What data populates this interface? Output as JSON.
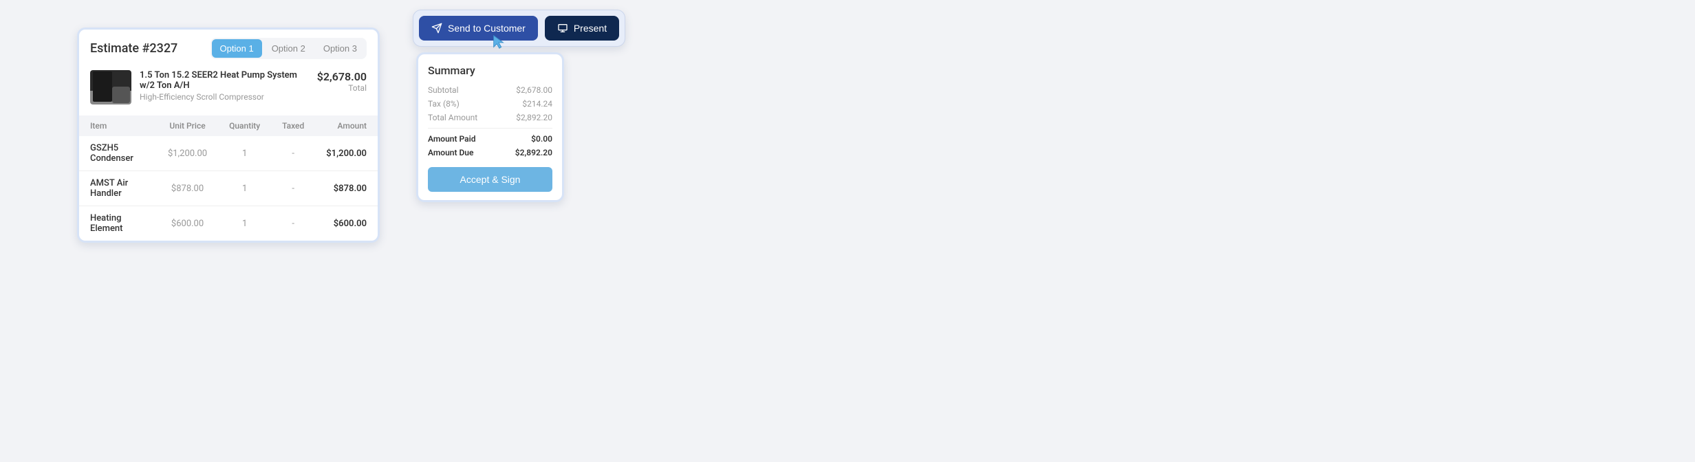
{
  "estimate": {
    "title": "Estimate #2327",
    "tabs": [
      "Option 1",
      "Option 2",
      "Option 3"
    ],
    "product": {
      "name": "1.5 Ton 15.2 SEER2 Heat Pump System w/2 Ton A/H",
      "subtitle": "High-Efficiency Scroll Compressor",
      "total": "$2,678.00",
      "total_label": "Total"
    },
    "columns": {
      "item": "Item",
      "unit_price": "Unit Price",
      "quantity": "Quantity",
      "taxed": "Taxed",
      "amount": "Amount"
    },
    "items": [
      {
        "name": "GSZH5 Condenser",
        "unit_price": "$1,200.00",
        "quantity": "1",
        "taxed": "-",
        "amount": "$1,200.00"
      },
      {
        "name": "AMST Air Handler",
        "unit_price": "$878.00",
        "quantity": "1",
        "taxed": "-",
        "amount": "$878.00"
      },
      {
        "name": "Heating Element",
        "unit_price": "$600.00",
        "quantity": "1",
        "taxed": "-",
        "amount": "$600.00"
      }
    ]
  },
  "actions": {
    "send": "Send to Customer",
    "present": "Present"
  },
  "summary": {
    "title": "Summary",
    "rows": [
      {
        "label": "Subtotal",
        "value": "$2,678.00"
      },
      {
        "label": "Tax (8%)",
        "value": "$214.24"
      },
      {
        "label": "Total Amount",
        "value": "$2,892.20"
      }
    ],
    "paid": {
      "label": "Amount Paid",
      "value": "$0.00"
    },
    "due": {
      "label": "Amount Due",
      "value": "$2,892.20"
    },
    "accept": "Accept & Sign"
  }
}
